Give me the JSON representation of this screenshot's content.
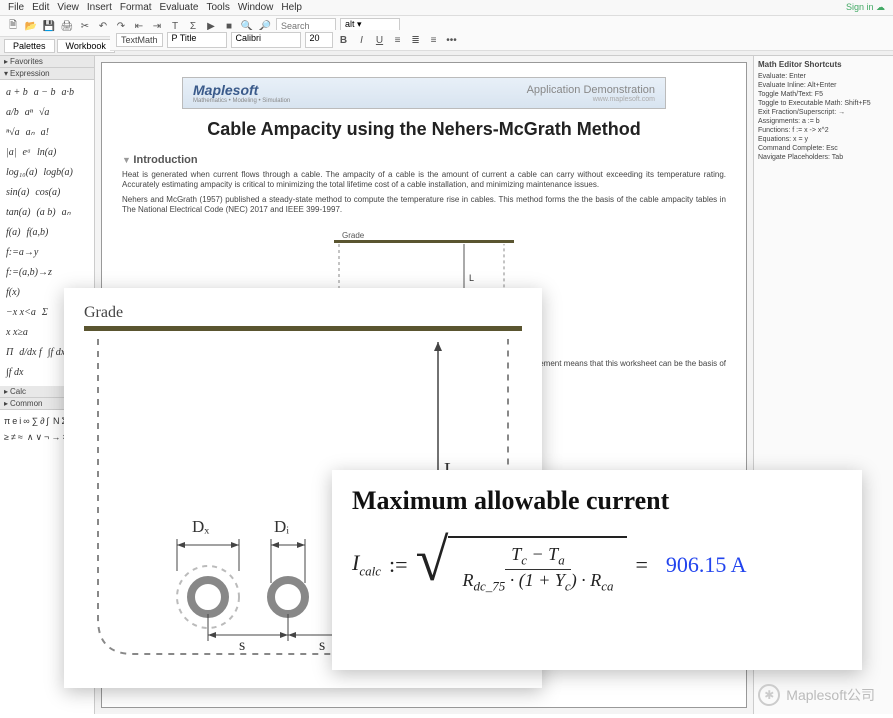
{
  "menu": [
    "File",
    "Edit",
    "View",
    "Insert",
    "Format",
    "Evaluate",
    "Tools",
    "Window",
    "Help"
  ],
  "signin": "Sign in",
  "tabs": {
    "palettes": "Palettes",
    "workbook": "Workbook"
  },
  "toolbar": {
    "mode": "TextMath",
    "format_label": "P Title",
    "font": "Calibri",
    "size": "20",
    "search_placeholder": "Search"
  },
  "palettes": {
    "favorites": "Favorites",
    "expression": "Expression",
    "calc": "Calc",
    "common": "Common"
  },
  "expressions": [
    "a + b",
    "a − b",
    "a·b",
    "a/b",
    "aⁿ",
    "√a",
    "ⁿ√a",
    "aₙ",
    "a!",
    "|a|",
    "eᵃ",
    "ln(a)",
    "log₁₀(a)",
    "logb(a)",
    "sin(a)",
    "cos(a)",
    "tan(a)",
    "(a b)",
    "aₙ",
    "f(a)",
    "f(a,b)",
    "f:=a→y",
    "f:=(a,b)→z",
    "f(x)",
    "−x x<a",
    "Σ",
    "x x≥a",
    "Π",
    "d/dx f",
    "∫f dx",
    "∫f dx"
  ],
  "doc": {
    "banner_logo": "Maplesoft",
    "banner_tagline": "Mathematics • Modeling • Simulation",
    "banner_title": "Application Demonstration",
    "banner_url": "www.maplesoft.com",
    "title": "Cable Ampacity using the Nehers-McGrath Method",
    "intro_head": "Introduction",
    "para1": "Heat is generated when current flows through a cable. The ampacity of a cable is the amount of current a cable can carry without exceeding its temperature rating. Accurately estimating ampacity is critical to minimizing the total lifetime cost of a cable installation, and minimizing maintenance issues.",
    "para2": "Nehers and McGrath (1957) published a steady-state method to compute the temperature rise in cables. This method forms the the basis of the cable ampacity tables in The National Electrical Code (NEC) 2017 and IEEE 399-1997.",
    "para3_frag": "C; the good agreement means that this worksheet can be the basis of",
    "grade": "Grade",
    "dim_L": "L",
    "dim_Dx": "Dₓ",
    "dim_Di": "Dᵢ",
    "dim_s": "s"
  },
  "shortcuts": {
    "title": "Math Editor Shortcuts",
    "lines": [
      "Evaluate:  Enter",
      "Evaluate Inline:  Alt+Enter",
      "Toggle Math/Text:  F5",
      "Toggle to Executable Math:  Shift+F5",
      "Exit Fraction/Superscript:  →",
      "Assignments:  a := b",
      "Functions:  f := x -> x^2",
      "Equations:  x = y",
      "Command Complete:  Esc",
      "Navigate Placeholders:  Tab"
    ]
  },
  "equation": {
    "title": "Maximum allowable current",
    "lhs_var": "I",
    "lhs_sub": "calc",
    "assign": ":=",
    "num_l": "T",
    "num_l_sub": "c",
    "num_r": "T",
    "num_r_sub": "a",
    "den_a": "R",
    "den_a_sub": "dc_75",
    "den_b": "1 + Y",
    "den_b_sub": "c",
    "den_c": "R",
    "den_c_sub": "ca",
    "result": "906.15 A"
  },
  "watermark": "Maplesoft公司"
}
